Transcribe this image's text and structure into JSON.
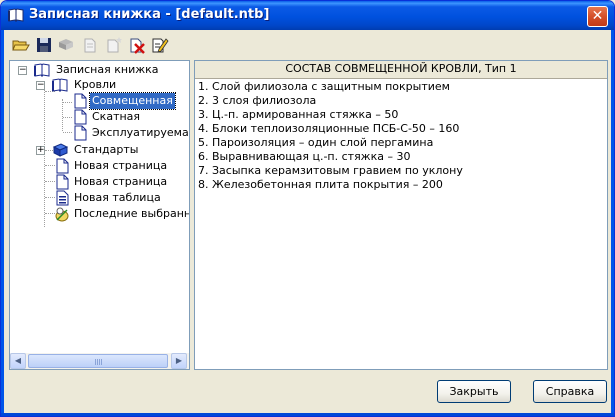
{
  "window": {
    "title": "Записная книжка - [default.ntb]",
    "close_glyph": "✕",
    "title_icon": "book-icon"
  },
  "toolbar": {
    "buttons": [
      {
        "name": "open-icon",
        "enabled": true
      },
      {
        "name": "save-icon",
        "enabled": true
      },
      {
        "name": "books-icon",
        "enabled": false
      },
      {
        "name": "new-page-icon",
        "enabled": false
      },
      {
        "name": "new-item-icon",
        "enabled": false
      },
      {
        "name": "delete-icon",
        "enabled": true
      },
      {
        "name": "edit-icon",
        "enabled": true
      }
    ]
  },
  "tree": {
    "root": "Записная книжка",
    "roofs": "Кровли",
    "combined": "Совмещенная",
    "pitched": "Скатная",
    "exploited": "Эксплуатируемая",
    "standards": "Стандарты",
    "new_page_1": "Новая страница",
    "new_page_2": "Новая страница",
    "new_table": "Новая таблица",
    "recent": "Последние выбранные",
    "expand_minus": "−",
    "expand_plus": "+"
  },
  "content": {
    "header": "СОСТАВ СОВМЕЩЕННОЙ КРОВЛИ, Тип 1",
    "lines": [
      "1. Слой филиозола с защитным покрытием",
      "2. 3 слоя филиозола",
      "3. Ц.-п. армированная стяжка – 50",
      "4. Блоки теплоизоляционные ПСБ-С-50 – 160",
      "5. Пароизоляция – один слой пергамина",
      "6. Выравнивающая ц.-п. стяжка – 30",
      "7. Засыпка керамзитовым гравием по уклону",
      "8. Железобетонная плита покрытия – 200"
    ]
  },
  "buttons": {
    "close": "Закрыть",
    "help": "Справка"
  },
  "scrollbar": {
    "left_arrow": "◀",
    "right_arrow": "▶"
  }
}
